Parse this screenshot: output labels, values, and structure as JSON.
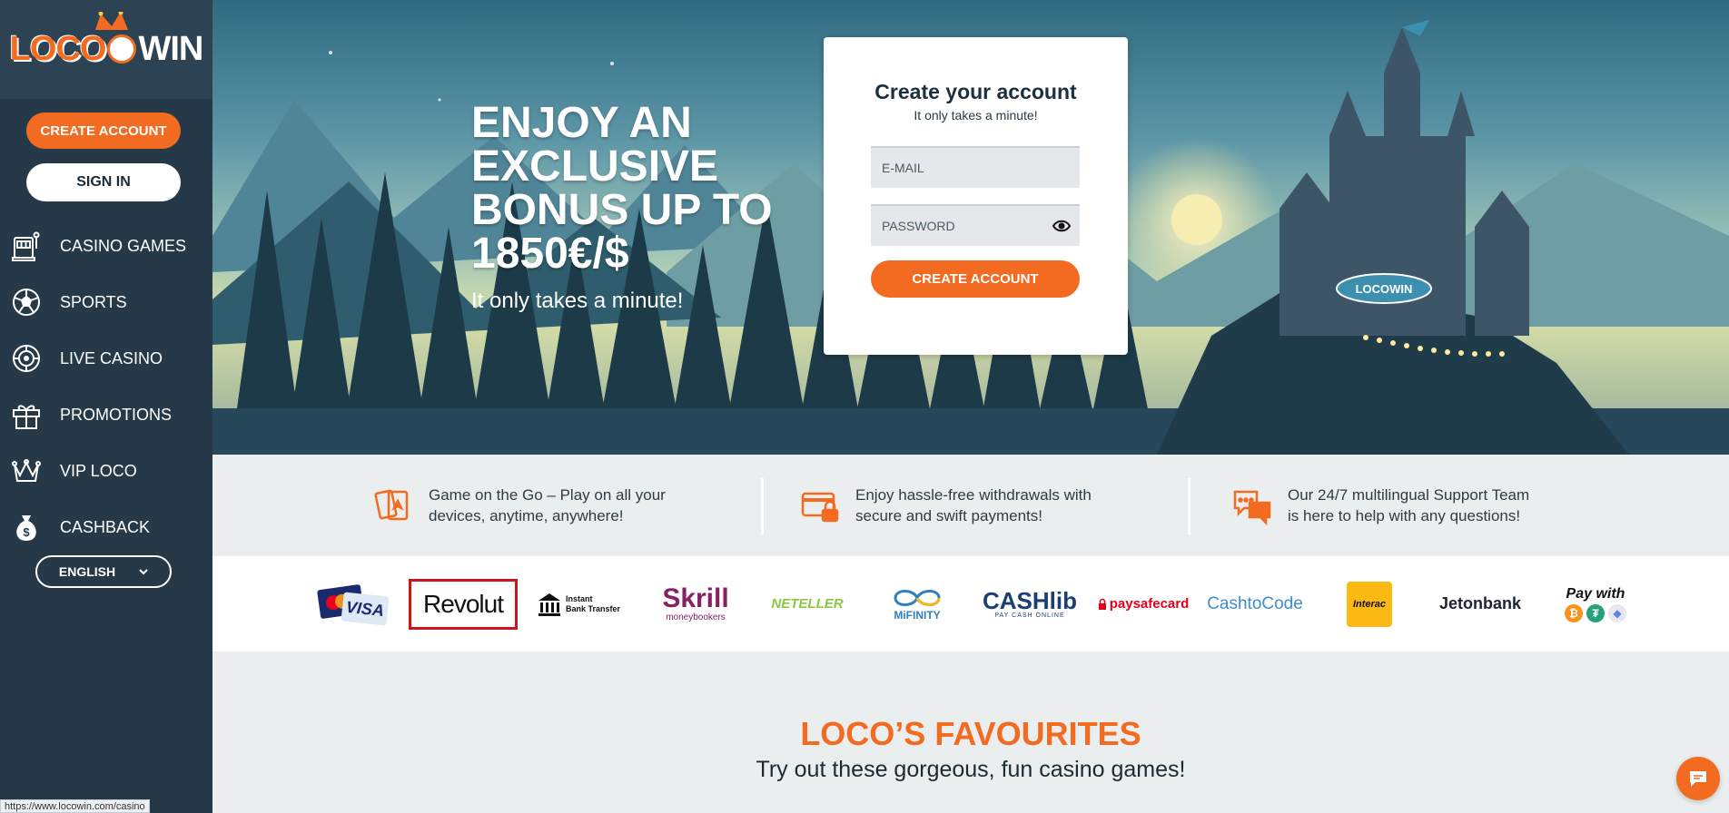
{
  "logo": {
    "text_left": "LOCO",
    "text_right": "WIN"
  },
  "sidebar": {
    "create_account": "CREATE ACCOUNT",
    "sign_in": "SIGN IN",
    "items": [
      {
        "label": "CASINO GAMES",
        "icon": "slot-machine-icon"
      },
      {
        "label": "SPORTS",
        "icon": "soccer-ball-icon"
      },
      {
        "label": "LIVE CASINO",
        "icon": "roulette-icon"
      },
      {
        "label": "PROMOTIONS",
        "icon": "gift-icon"
      },
      {
        "label": "VIP LOCO",
        "icon": "crown-icon"
      },
      {
        "label": "CASHBACK",
        "icon": "money-bag-icon"
      }
    ],
    "language": "ENGLISH"
  },
  "hero": {
    "title": "ENJOY AN EXCLUSIVE BONUS UP TO 1850€/$",
    "subtitle": "It only takes a minute!"
  },
  "signup": {
    "title": "Create your account",
    "subtitle": "It only takes a minute!",
    "email_placeholder": "E-MAIL",
    "password_placeholder": "PASSWORD",
    "submit": "CREATE ACCOUNT"
  },
  "features": [
    {
      "line1": "Game on the Go – Play on all your",
      "line2": "devices, anytime, anywhere!",
      "icon": "cards-icon"
    },
    {
      "line1": "Enjoy hassle-free withdrawals with",
      "line2": "secure and swift payments!",
      "icon": "secure-card-icon"
    },
    {
      "line1": "Our 24/7 multilingual Support Team",
      "line2": "is here to help with any questions!",
      "icon": "chat-bubbles-icon"
    }
  ],
  "payments": {
    "visa": "VISA",
    "revolut": "Revolut",
    "bank_line1": "Instant",
    "bank_line2": "Bank Transfer",
    "skrill": "Skrill",
    "skrill_sub": "moneybookers",
    "neteller": "NETELLER",
    "mifinity": "MiFINITY",
    "cashlib": "CASHlib",
    "cashlib_sub": "PAY CASH ONLINE",
    "paysafecard": "paysafecard",
    "cashtocode": "CashtoCode",
    "interac": "Interac",
    "jetonbank": "Jetonbank",
    "paywith": "Pay with"
  },
  "favourites": {
    "title": "LOCO’S FAVOURITES",
    "subtitle": "Try out these gorgeous, fun casino games!"
  },
  "status_url": "https://www.locowin.com/casino",
  "colors": {
    "accent": "#f36b21",
    "sidebar": "#263948",
    "text_dark": "#1c2f3d"
  }
}
